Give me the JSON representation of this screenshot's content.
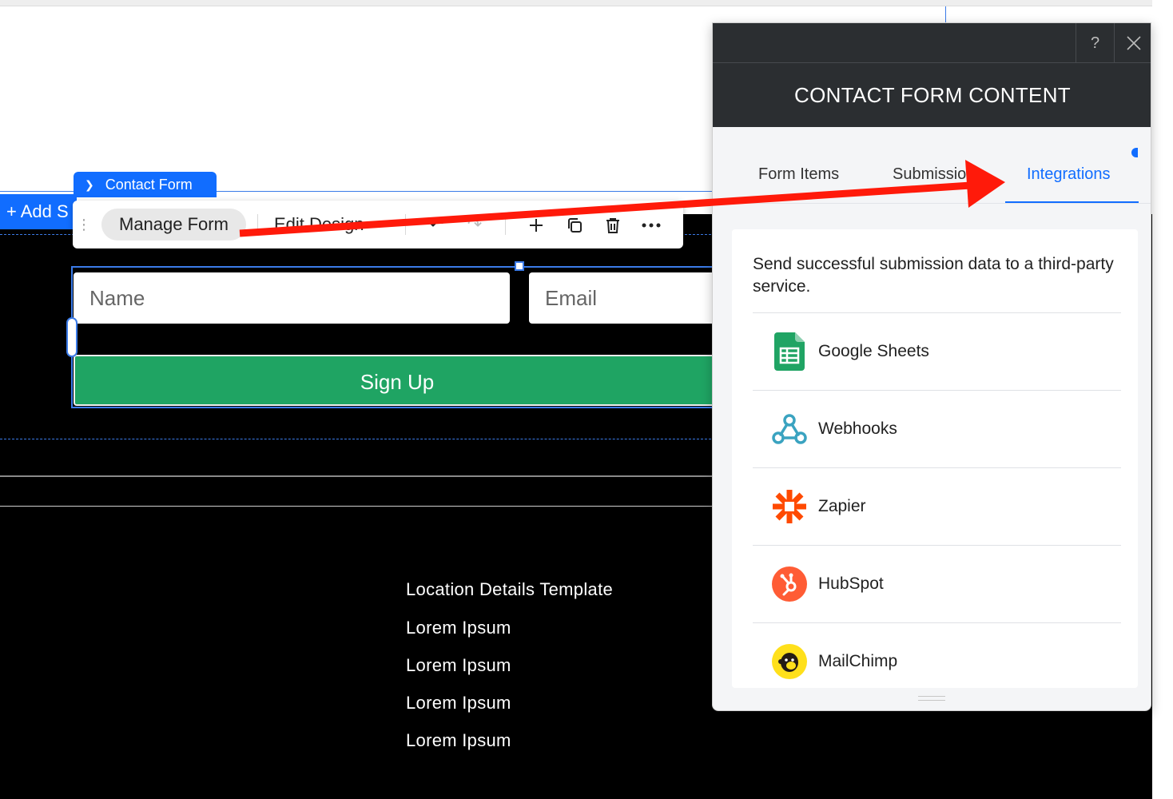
{
  "editor": {
    "add_section_label": "+ Add S",
    "element_tag": "Contact Form",
    "toolbar": {
      "manage_form": "Manage Form",
      "edit_design": "Edit Design"
    }
  },
  "form": {
    "name_placeholder": "Name",
    "email_placeholder": "Email",
    "submit_label": "Sign Up"
  },
  "footer": {
    "heading": "Location Details Template",
    "lines": [
      "Lorem Ipsum",
      "Lorem Ipsum",
      "Lorem Ipsum",
      "Lorem Ipsum"
    ]
  },
  "panel": {
    "title": "CONTACT FORM CONTENT",
    "help_label": "?",
    "tabs": [
      {
        "label": "Form Items"
      },
      {
        "label": "Submissions"
      },
      {
        "label": "Integrations"
      }
    ],
    "active_tab": "Integrations",
    "description": "Send successful submission data to a third-party service.",
    "integrations": [
      {
        "label": "Google Sheets",
        "icon": "google-sheets-icon"
      },
      {
        "label": "Webhooks",
        "icon": "webhooks-icon"
      },
      {
        "label": "Zapier",
        "icon": "zapier-icon"
      },
      {
        "label": "HubSpot",
        "icon": "hubspot-icon"
      },
      {
        "label": "MailChimp",
        "icon": "mailchimp-icon"
      }
    ]
  },
  "colors": {
    "accent": "#116dff",
    "panel_header": "#2b2e31",
    "signup_button": "#1fa463",
    "annotation_arrow": "#ff1a0a"
  }
}
